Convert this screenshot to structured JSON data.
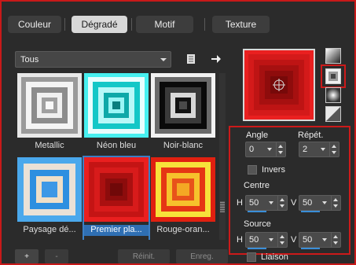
{
  "tabs": [
    {
      "label": "Couleur",
      "active": false
    },
    {
      "label": "Dégradé",
      "active": true
    },
    {
      "label": "Motif",
      "active": false
    },
    {
      "label": "Texture",
      "active": false
    }
  ],
  "category": {
    "selected": "Tous"
  },
  "gallery": [
    {
      "label": "Metallic",
      "icon": "gradient-metallic"
    },
    {
      "label": "Néon bleu",
      "icon": "gradient-neon-blue"
    },
    {
      "label": "Noir-blanc",
      "icon": "gradient-black-white"
    },
    {
      "label": "Paysage dé...",
      "icon": "gradient-landscape"
    },
    {
      "label": "Premier pla...",
      "icon": "gradient-foreground",
      "selected": true
    },
    {
      "label": "Rouge-oran...",
      "icon": "gradient-red-orange"
    }
  ],
  "buttons": {
    "add": "+",
    "remove": "-",
    "reset": "Réinit.",
    "save": "Enreg."
  },
  "controls": {
    "angle_label": "Angle",
    "angle_value": "0",
    "repeat_label": "Répét.",
    "repeat_value": "2",
    "invert_label": "Invers",
    "center_label": "Centre",
    "center_h_label": "H",
    "center_h_value": "50",
    "center_v_label": "V",
    "center_v_value": "50",
    "source_label": "Source",
    "source_h_label": "H",
    "source_h_value": "50",
    "source_v_label": "V",
    "source_v_value": "50",
    "link_label": "Liaison"
  },
  "colors": {
    "accent_red": "#cc1a1a",
    "selection_blue": "#2f6fb3",
    "preview_outer": "#e8201f",
    "preview_inner": "#7d0a0a"
  },
  "icons": {
    "new_doc": "document-icon",
    "arrow": "arrow-right-icon",
    "style_linear": "linear-gradient-icon",
    "style_rectangular": "rectangular-gradient-icon",
    "style_radial": "radial-gradient-icon",
    "style_sunburst": "sunburst-gradient-icon"
  }
}
